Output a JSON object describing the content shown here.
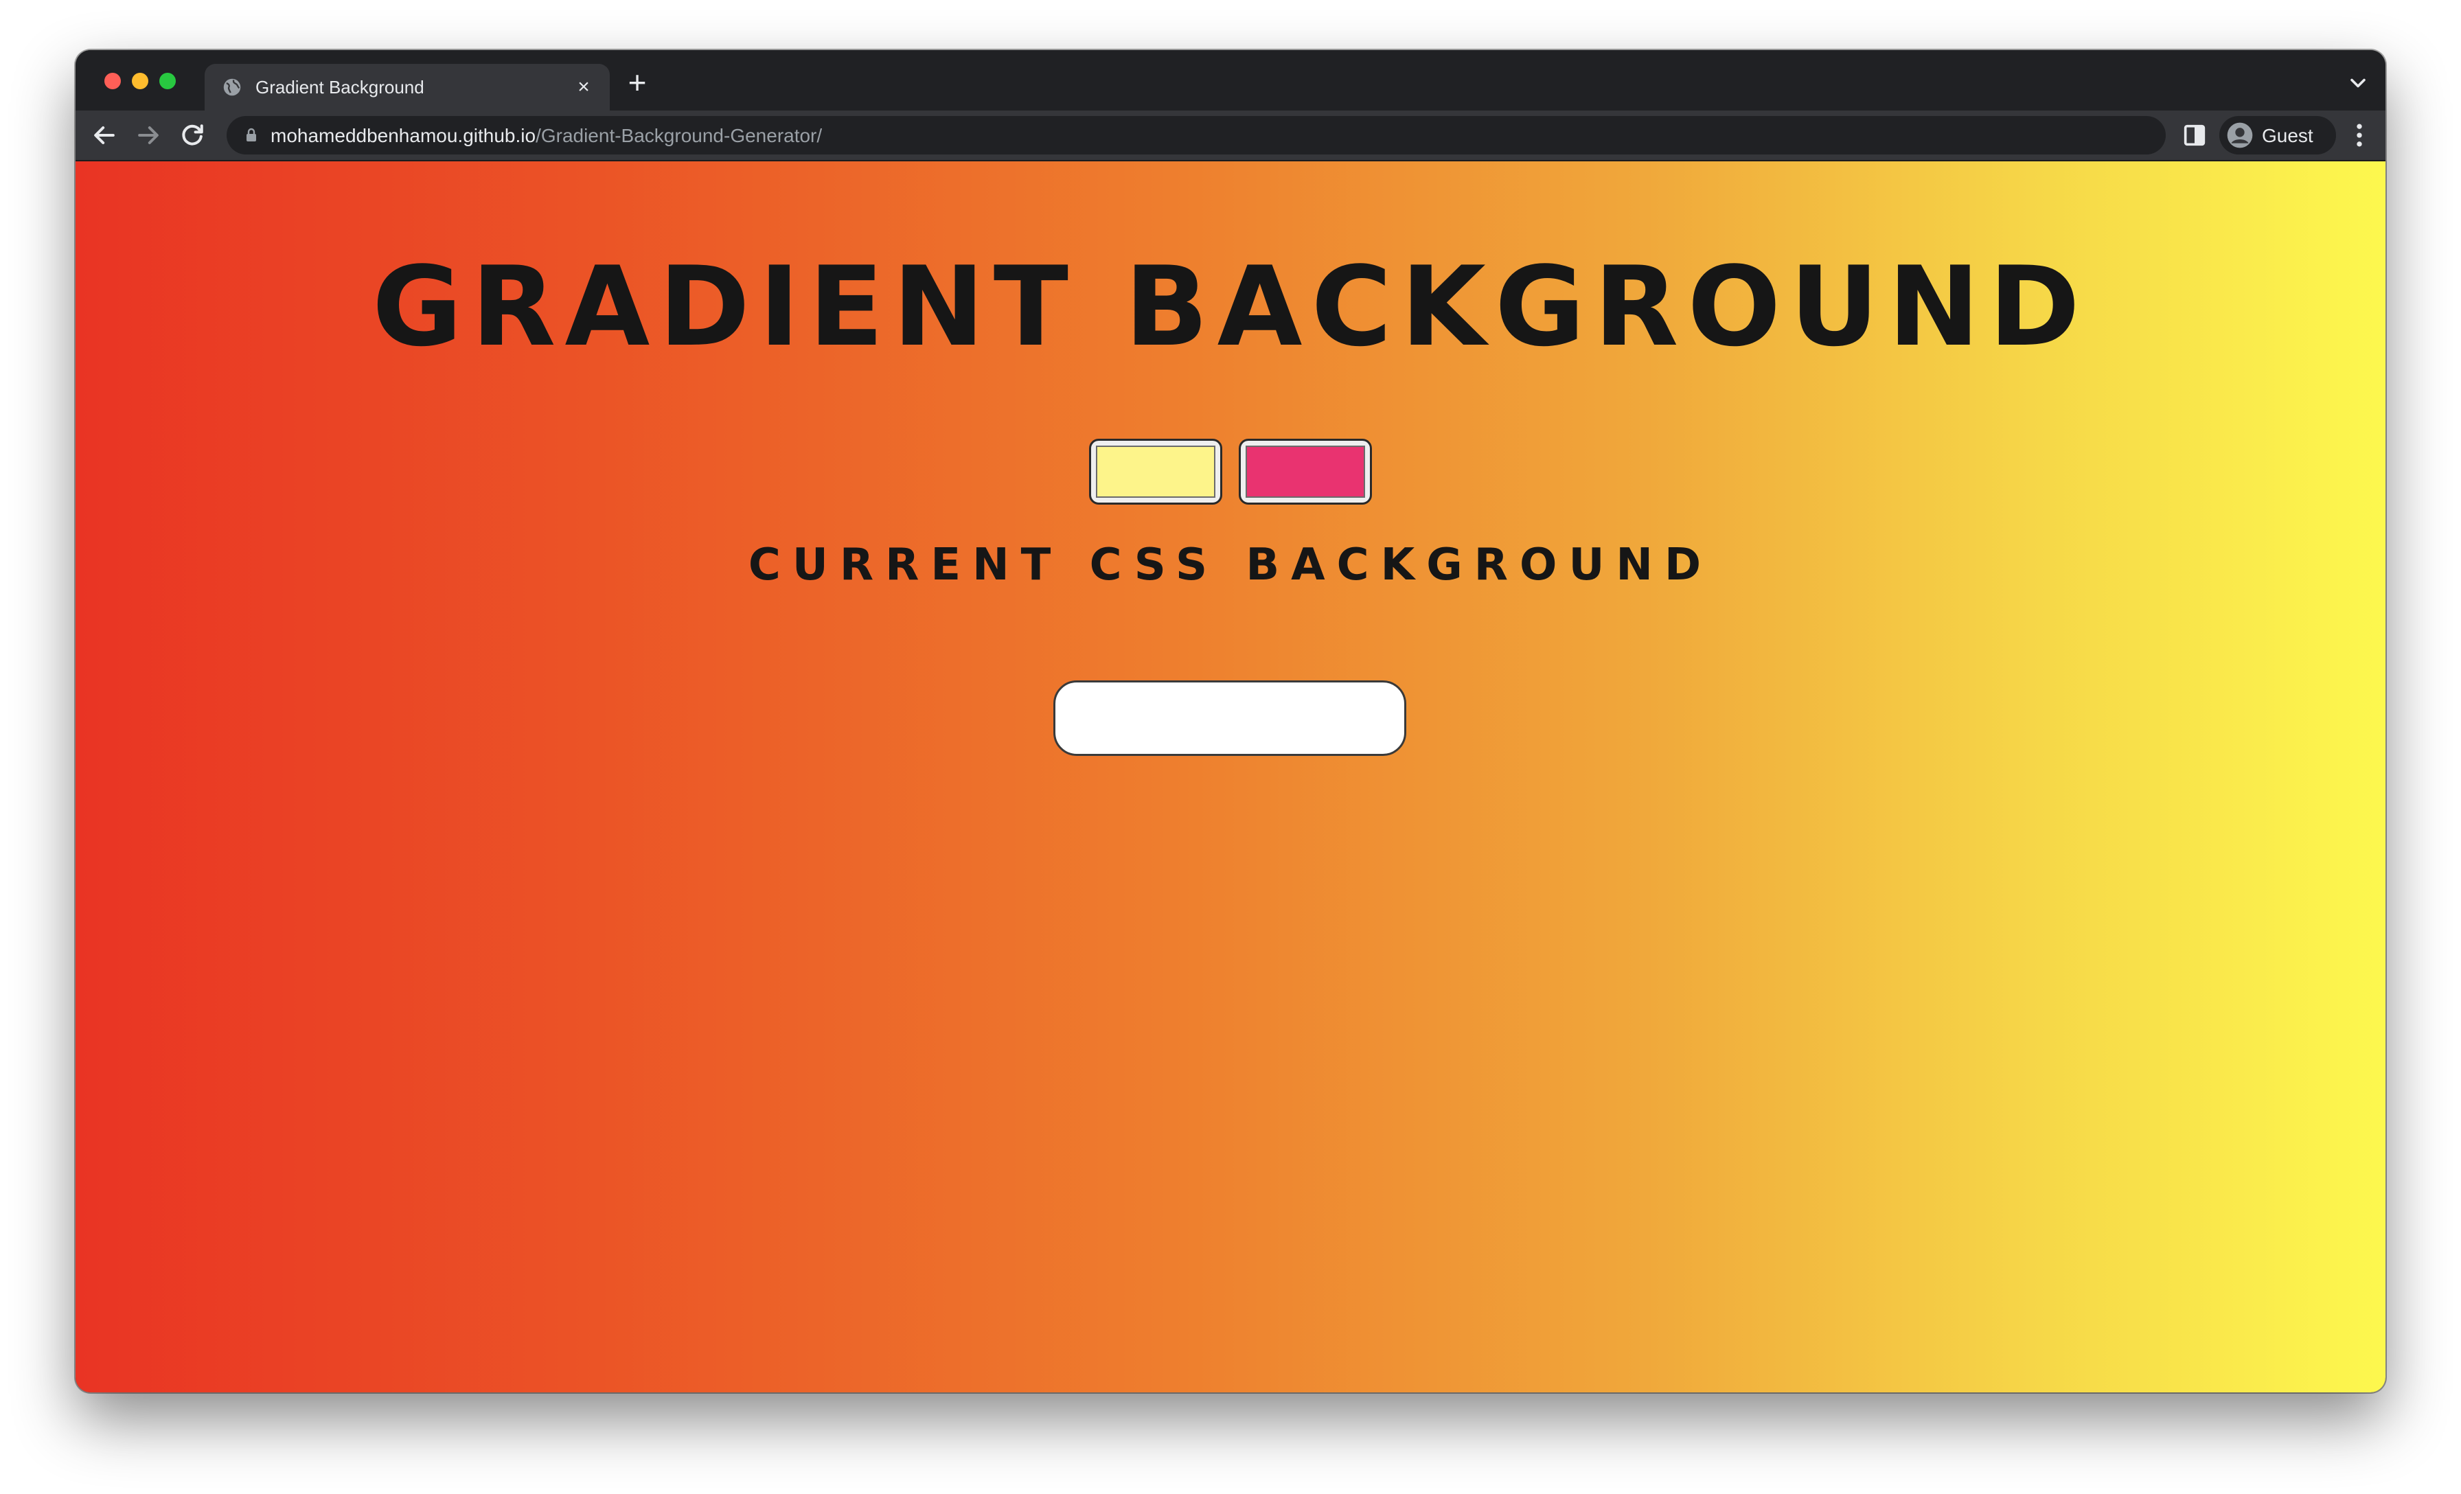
{
  "browser": {
    "tab": {
      "title": "Gradient Background",
      "close_glyph": "×"
    },
    "new_tab_glyph": "+",
    "address": {
      "host": "mohameddbenhamou.github.io",
      "path": "/Gradient-Background-Generator/"
    },
    "profile_label": "Guest"
  },
  "page": {
    "title": "GRADIENT BACKGROUND",
    "subtitle": "CURRENT CSS BACKGROUND",
    "css_output": "",
    "color_inputs": [
      {
        "name": "color-1",
        "value": "#fdf48a"
      },
      {
        "name": "color-2",
        "value": "#e93370"
      }
    ],
    "gradient_colors": [
      "#e93424",
      "#fdf84e"
    ]
  },
  "icons": {
    "tab_favicon": "globe-icon",
    "tab_close": "close-icon",
    "new_tab": "plus-icon",
    "tab_search": "chevron-down-icon",
    "back": "arrow-left-icon",
    "forward": "arrow-right-icon",
    "reload": "reload-icon",
    "lock": "lock-icon",
    "side_panel": "side-panel-icon",
    "avatar": "person-icon",
    "menu": "kebab-menu-icon"
  }
}
